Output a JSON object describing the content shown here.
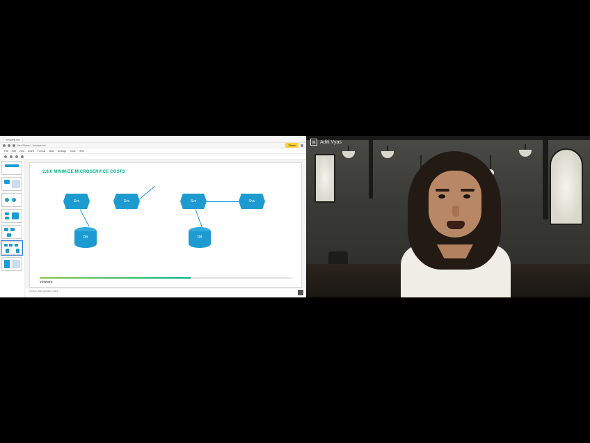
{
  "video_call": {
    "participant_name": "Aditi Vyas",
    "logo_glyph": "⊞"
  },
  "browser": {
    "tab_title": "vmware.md",
    "url_display": "file:///Users/.../vmware.md",
    "share_label": "Share"
  },
  "slides": {
    "menu": [
      "File",
      "Edit",
      "View",
      "Insert",
      "Format",
      "Slide",
      "Arrange",
      "Tools",
      "Help"
    ],
    "title": "2.8.6 MINIMIZE MICROSERVICE COSTS",
    "brand": "vmware",
    "notes_placeholder": "Click to add speaker notes"
  },
  "diagram": {
    "group_a": {
      "hex1": "Svc",
      "hex2": "Svc",
      "db": "DB"
    },
    "group_b": {
      "hex1": "Svc",
      "hex2": "Svc",
      "db": "DB"
    }
  }
}
